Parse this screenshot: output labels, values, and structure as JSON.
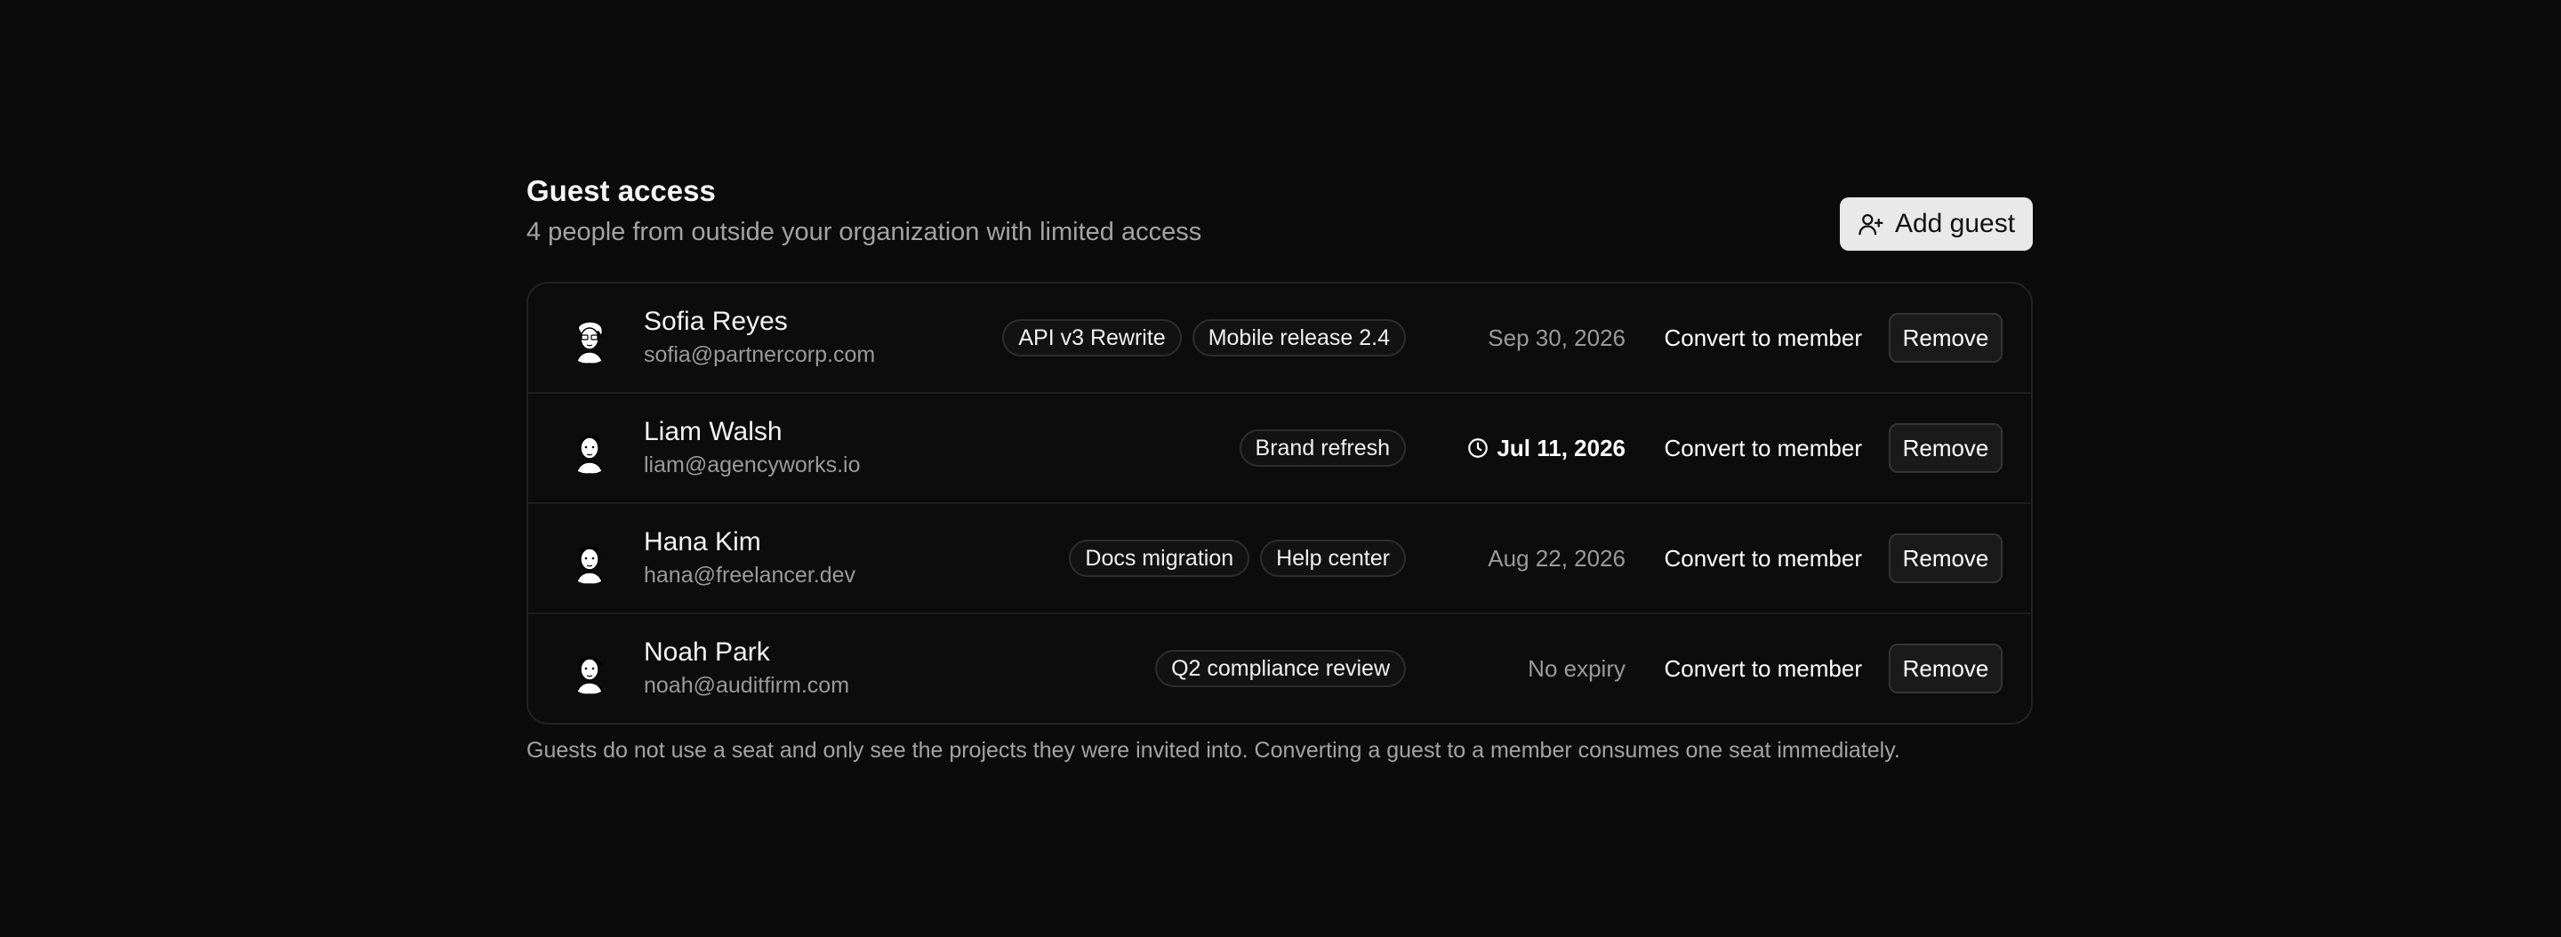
{
  "header": {
    "title": "Guest access",
    "subtitle": "4 people from outside your organization with limited access",
    "add_button_label": "Add guest",
    "add_button_icon": "user-plus-icon"
  },
  "guests": [
    {
      "name": "Sofia Reyes",
      "email": "sofia@partnercorp.com",
      "projects": [
        "API v3 Rewrite",
        "Mobile release 2.4"
      ],
      "expiry": "Sep 30, 2026",
      "expiring_soon": false
    },
    {
      "name": "Liam Walsh",
      "email": "liam@agencyworks.io",
      "projects": [
        "Brand refresh"
      ],
      "expiry": "Jul 11, 2026",
      "expiring_soon": true
    },
    {
      "name": "Hana Kim",
      "email": "hana@freelancer.dev",
      "projects": [
        "Docs migration",
        "Help center"
      ],
      "expiry": "Aug 22, 2026",
      "expiring_soon": false
    },
    {
      "name": "Noah Park",
      "email": "noah@auditfirm.com",
      "projects": [
        "Q2 compliance review"
      ],
      "expiry": "No expiry",
      "expiring_soon": false
    }
  ],
  "actions": {
    "convert_label": "Convert to member",
    "remove_label": "Remove"
  },
  "footnote": "Guests do not use a seat and only see the projects they were invited into. Converting a guest to a member consumes one seat immediately.",
  "colors": {
    "background": "#0b0b0b",
    "add_button_bg": "#e9e9e9",
    "muted_text": "#9a9a9a"
  }
}
